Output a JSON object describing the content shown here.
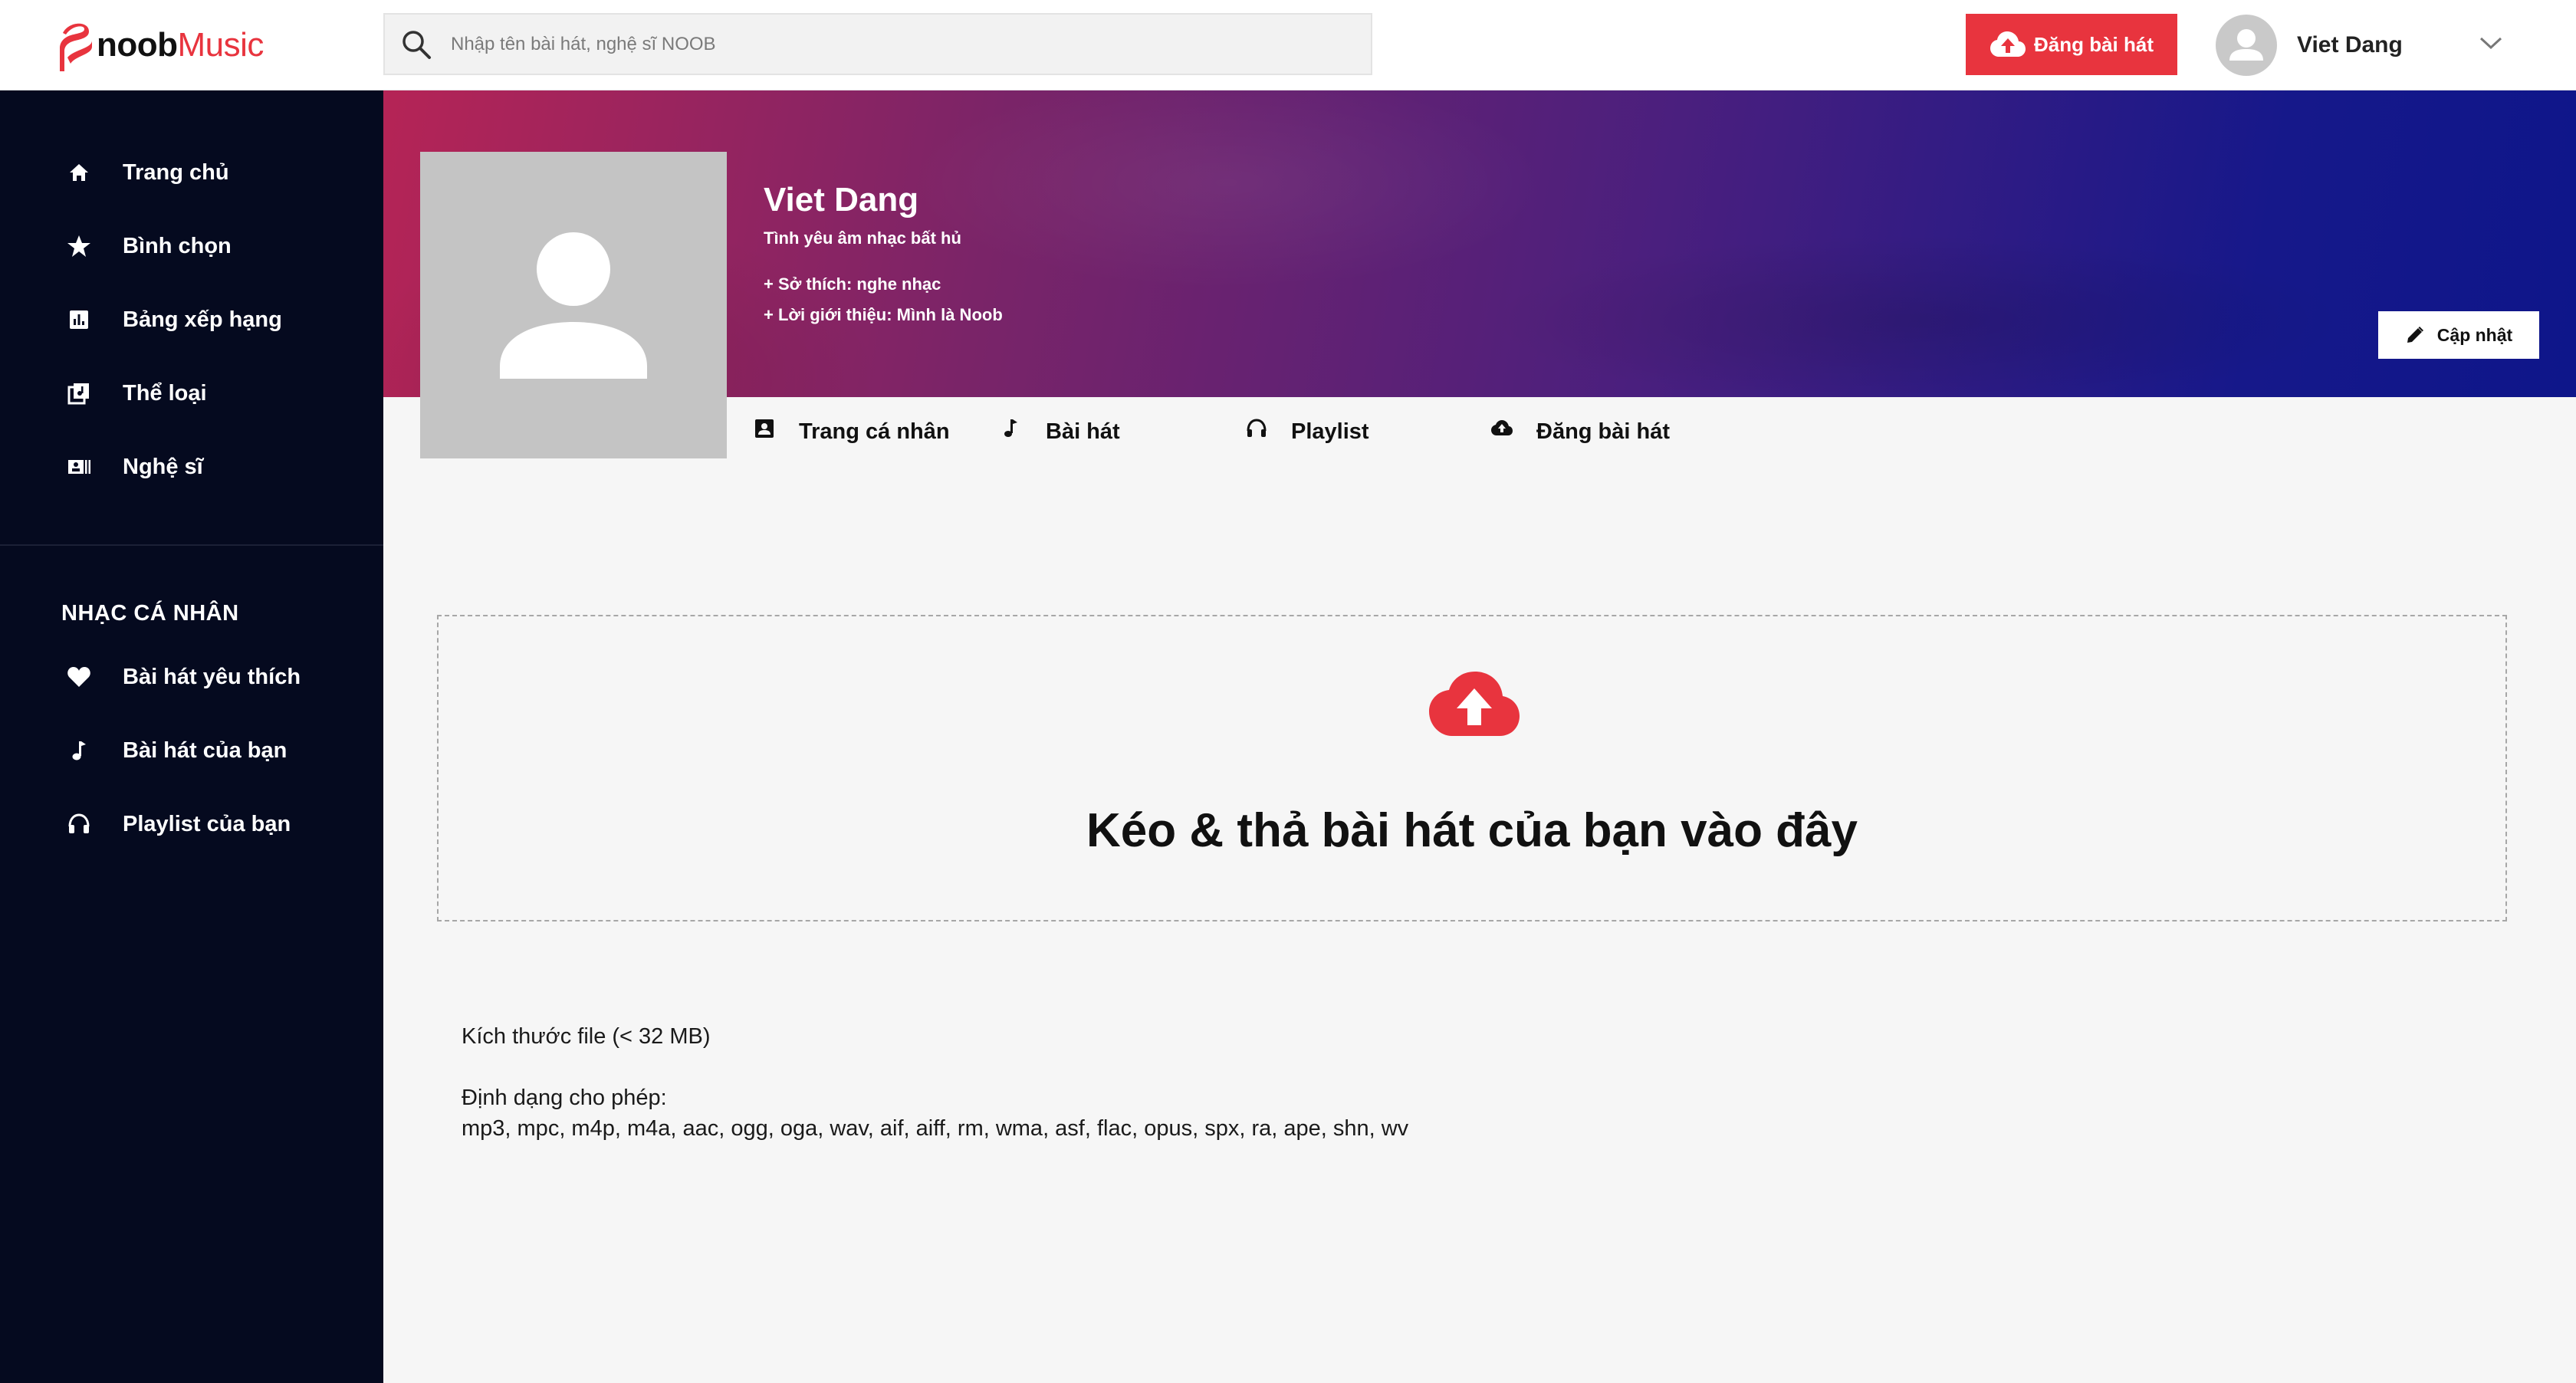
{
  "brand": {
    "name_part1": "noob",
    "name_part2": "Music",
    "accent": "#e8343e"
  },
  "header": {
    "search_placeholder": "Nhập tên bài hát, nghệ sĩ NOOB",
    "upload_button": "Đăng bài hát",
    "user_name": "Viet Dang"
  },
  "sidebar": {
    "items": [
      {
        "label": "Trang chủ",
        "icon": "home-icon"
      },
      {
        "label": "Bình chọn",
        "icon": "star-icon"
      },
      {
        "label": "Bảng xếp hạng",
        "icon": "chart-icon"
      },
      {
        "label": "Thể loại",
        "icon": "library-icon"
      },
      {
        "label": "Nghệ sĩ",
        "icon": "artist-icon"
      }
    ],
    "section_title": "NHẠC CÁ NHÂN",
    "personal_items": [
      {
        "label": "Bài hát yêu thích",
        "icon": "heart-icon"
      },
      {
        "label": "Bài hát của bạn",
        "icon": "music-note-icon"
      },
      {
        "label": "Playlist của bạn",
        "icon": "headphones-icon"
      }
    ]
  },
  "profile": {
    "name": "Viet Dang",
    "slogan": "Tình yêu âm nhạc bất hủ",
    "hobby": "+ Sở thích: nghe nhạc",
    "intro": "+ Lời giới thiệu: Mình là Noob",
    "update_button": "Cập nhật"
  },
  "tabs": [
    {
      "label": "Trang cá nhân",
      "icon": "profile-card-icon"
    },
    {
      "label": "Bài hát",
      "icon": "music-note-icon"
    },
    {
      "label": "Playlist",
      "icon": "headphones-icon"
    },
    {
      "label": "Đăng bài hát",
      "icon": "cloud-upload-icon"
    }
  ],
  "dropzone": {
    "text": "Kéo & thả bài hát của bạn vào đây"
  },
  "info": {
    "file_size": "Kích thước file (< 32 MB)",
    "formats_label": "Định dạng cho phép:",
    "formats": "mp3, mpc, m4p, m4a, aac, ogg, oga, wav, aif, aiff, rm, wma, asf, flac, opus, spx, ra, ape, shn, wv"
  }
}
